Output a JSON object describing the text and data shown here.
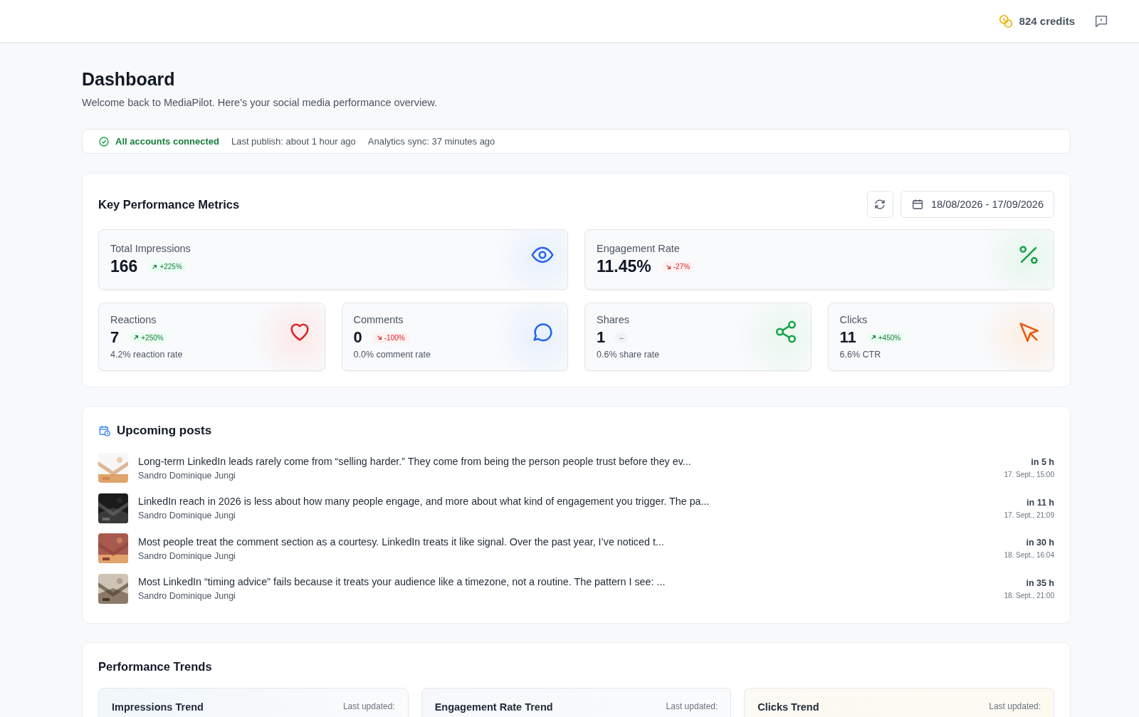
{
  "header": {
    "credits": "824 credits"
  },
  "page": {
    "title": "Dashboard",
    "subtitle": "Welcome back to MediaPilot. Here's your social media performance overview."
  },
  "status": {
    "connected": "All accounts connected",
    "last_publish": "Last publish: about 1 hour ago",
    "sync": "Analytics sync: 37 minutes ago"
  },
  "kpi": {
    "title": "Key Performance Metrics",
    "date_range": "18/08/2026 - 17/09/2026",
    "metrics": [
      {
        "kind": "impressions",
        "label": "Total Impressions",
        "value": "166",
        "change": "+225%",
        "rising": true,
        "falling": false
      },
      {
        "kind": "engagement",
        "label": "Engagement Rate",
        "value": "11.45%",
        "change": "-27%",
        "rising": false,
        "falling": true
      },
      {
        "kind": "reactions",
        "label": "Reactions",
        "value": "7",
        "change": "+250%",
        "rising": true,
        "falling": false,
        "note": "4.2% reaction rate"
      },
      {
        "kind": "comments",
        "label": "Comments",
        "value": "0",
        "change": "-100%",
        "rising": false,
        "falling": true,
        "note": "0.0% comment rate"
      },
      {
        "kind": "shares",
        "label": "Shares",
        "value": "1",
        "change": "–",
        "rising": false,
        "falling": false,
        "note": "0.6% share rate"
      },
      {
        "kind": "clicks",
        "label": "Clicks",
        "value": "11",
        "change": "+450%",
        "rising": true,
        "falling": false,
        "note": "6.6% CTR"
      }
    ]
  },
  "upcoming": {
    "title": "Upcoming posts",
    "posts": [
      {
        "text": "Long-term LinkedIn leads rarely come from “selling harder.” They come from being the person people trust before they ev...",
        "author": "Sandro Dominique Jungi",
        "relative": "in 5 h",
        "date": "17. Sept., 15:00"
      },
      {
        "text": "LinkedIn reach in 2026 is less about how many people engage, and more about what kind of engagement you trigger. The pa...",
        "author": "Sandro Dominique Jungi",
        "relative": "in 11 h",
        "date": "17. Sept., 21:09"
      },
      {
        "text": "Most people treat the comment section as a courtesy. LinkedIn treats it like signal. Over the past year, I’ve noticed t...",
        "author": "Sandro Dominique Jungi",
        "relative": "in 30 h",
        "date": "18. Sept., 16:04"
      },
      {
        "text": "Most LinkedIn “timing advice” fails because it treats your audience like a timezone, not a routine. The pattern I see: ...",
        "author": "Sandro Dominique Jungi",
        "relative": "in 35 h",
        "date": "18. Sept., 21:00"
      }
    ]
  },
  "trends": {
    "title": "Performance Trends",
    "cards": [
      {
        "kind": "impressions",
        "title": "Impressions Trend",
        "updated": "Last updated:"
      },
      {
        "kind": "engagement",
        "title": "Engagement Rate Trend",
        "updated": "Last updated:"
      },
      {
        "kind": "clicks",
        "title": "Clicks Trend",
        "updated": "Last updated:"
      }
    ]
  }
}
